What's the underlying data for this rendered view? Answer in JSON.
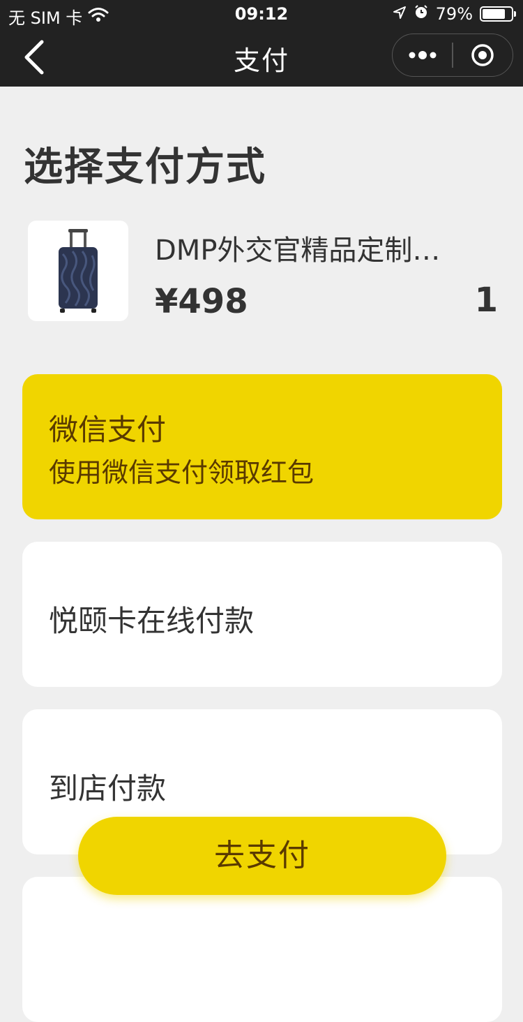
{
  "status_bar": {
    "carrier": "无 SIM 卡",
    "time": "09:12",
    "battery_text": "79%",
    "battery_level": 0.79
  },
  "nav": {
    "title": "支付"
  },
  "page": {
    "title": "选择支付方式"
  },
  "product": {
    "name": "DMP外交官精品定制…",
    "price": "¥498",
    "quantity": "1"
  },
  "payment_options": [
    {
      "title": "微信支付",
      "subtitle": "使用微信支付领取红包",
      "selected": true
    },
    {
      "title": "悦颐卡在线付款",
      "selected": false
    },
    {
      "title": "到店付款",
      "selected": false
    }
  ],
  "pay_button": {
    "label": "去支付"
  },
  "colors": {
    "accent": "#f0d500",
    "accent_text": "#5a3a00",
    "header_bg": "#222222",
    "page_bg": "#efefef"
  }
}
